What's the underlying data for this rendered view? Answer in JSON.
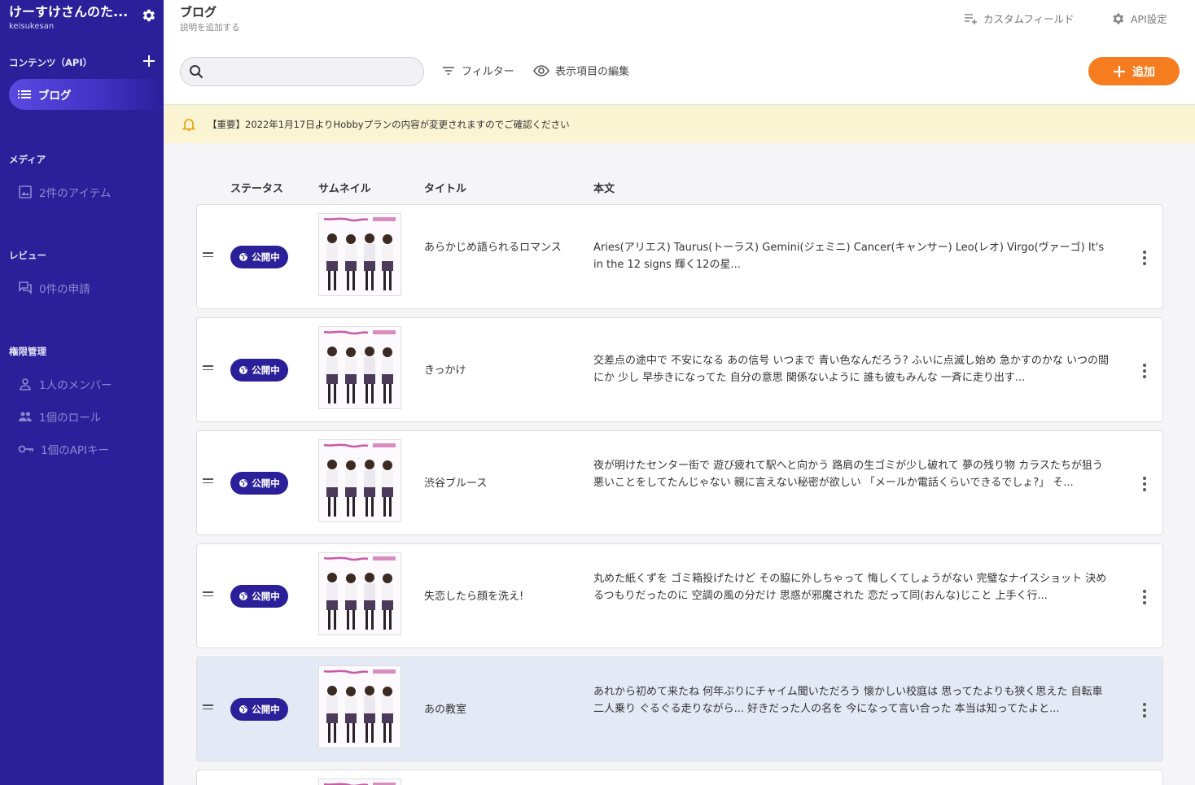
{
  "sidebar": {
    "service_name": "けーすけさんのた...",
    "service_id": "keisukesan",
    "sections": {
      "contents": "コンテンツ（API）",
      "media": "メディア",
      "review": "レビュー",
      "permissions": "権限管理"
    },
    "active_item": {
      "label": "ブログ",
      "icon": "list-icon"
    },
    "media_item": {
      "label": "2件のアイテム",
      "icon": "image-icon"
    },
    "review_item": {
      "label": "0件の申請",
      "icon": "chat-icon"
    },
    "members_item": {
      "label": "1人のメンバー",
      "icon": "person-icon"
    },
    "roles_item": {
      "label": "1個のロール",
      "icon": "people-icon"
    },
    "apikey_item": {
      "label": "1個のAPIキー",
      "icon": "key-icon"
    }
  },
  "header": {
    "title": "ブログ",
    "description": "説明を追加する",
    "custom_field_label": "カスタムフィールド",
    "api_settings_label": "API設定"
  },
  "toolbar": {
    "search_placeholder": "",
    "filter_label": "フィルター",
    "columns_label": "表示項目の編集",
    "add_label": "追加"
  },
  "notice": {
    "text": "【重要】2022年1月17日よりHobbyプランの内容が変更されますのでご確認ください"
  },
  "table": {
    "columns": [
      "ステータス",
      "サムネイル",
      "タイトル",
      "本文"
    ],
    "rows": [
      {
        "status": "公開中",
        "title": "あらかじめ語られるロマンス",
        "body": "Aries(アリエス) Taurus(トーラス) Gemini(ジェミニ) Cancer(キャンサー) Leo(レオ) Virgo(ヴァーゴ) It's in the 12 signs 輝く12の星..."
      },
      {
        "status": "公開中",
        "title": "きっかけ",
        "body": "交差点の途中で 不安になる あの信号 いつまで 青い色なんだろう? ふいに点滅し始め 急かすのかな いつの間にか 少し 早歩きになってた 自分の意思 関係ないように 誰も彼もみんな 一斉に走り出す..."
      },
      {
        "status": "公開中",
        "title": "渋谷ブルース",
        "body": "夜が明けたセンター街で 遊び疲れて駅へと向かう 路肩の生ゴミが少し破れて 夢の残り物 カラスたちが狙う 悪いことをしてたんじゃない 親に言えない秘密が欲しい 「メールか電話くらいできるでしょ?」 そ..."
      },
      {
        "status": "公開中",
        "title": "失恋したら顔を洗え!",
        "body": "丸めた紙くずを ゴミ箱投げたけど その脇に外しちゃって 悔しくてしょうがない 完璧なナイスショット 決めるつもりだったのに 空調の風の分だけ 思惑が邪魔された 恋だって同(おんな)じこと 上手く行..."
      },
      {
        "status": "公開中",
        "title": "あの教室",
        "body": "あれから初めて来たね 何年ぶりにチャイム聞いただろう 懐かしい校庭は 思ってたよりも狭く思えた 自転車 二人乗り ぐるぐる走りながら... 好きだった人の名を 今になって言い合った 本当は知ってたよと..."
      }
    ]
  },
  "colors": {
    "sidebar_bg": "#2b1f9a",
    "accent": "#f57c1f",
    "badge_bg": "#2b1f9a",
    "notice_bg": "#fbf4d3",
    "row_highlight": "#e4eaf5"
  }
}
